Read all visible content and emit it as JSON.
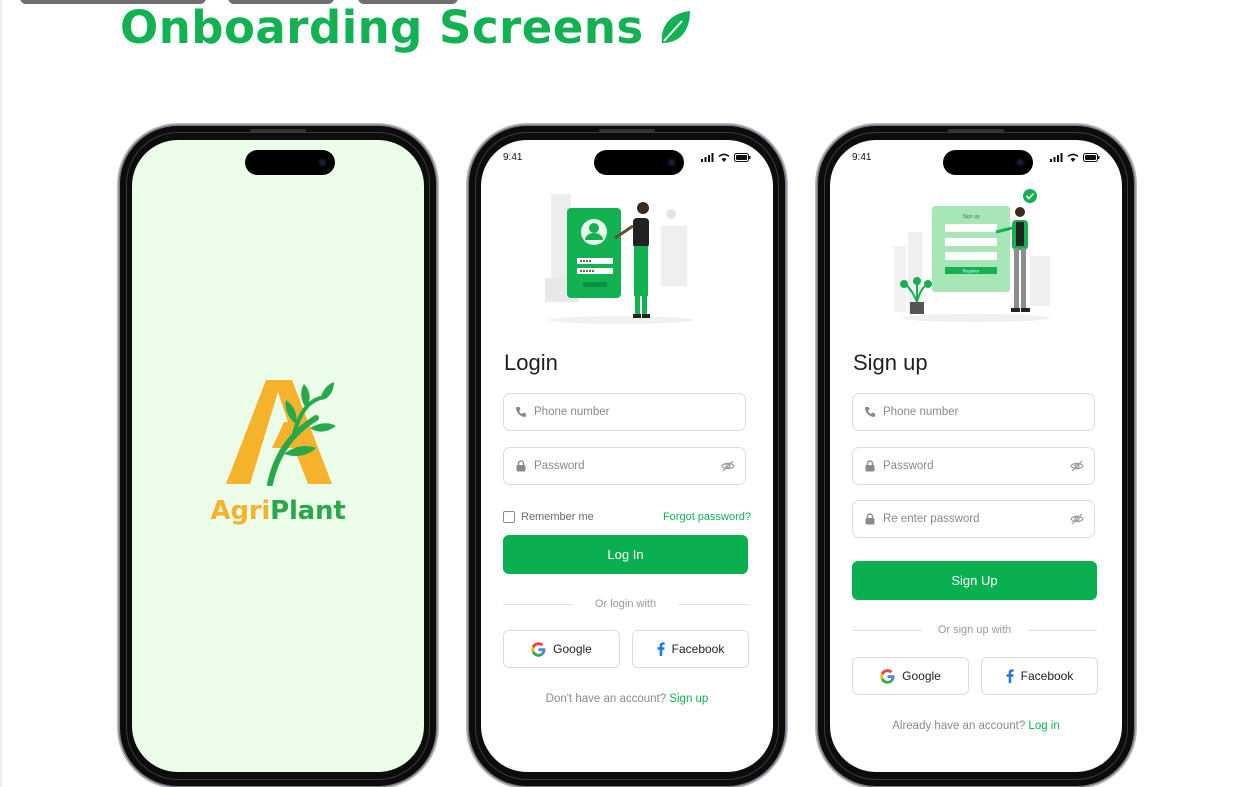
{
  "page": {
    "title": "Onboarding Screens",
    "accent": "#12b152"
  },
  "splash": {
    "brand_part1": "Agri",
    "brand_part2": "Plant",
    "brand_colors": [
      "#f4b32a",
      "#29a84a"
    ],
    "background": "#ebfde9"
  },
  "status": {
    "time": "9:41"
  },
  "login": {
    "title": "Login",
    "phone_placeholder": "Phone number",
    "password_placeholder": "Password",
    "remember_label": "Remember me",
    "forgot_label": "Forgot password?",
    "submit_label": "Log In",
    "divider_label": "Or login with",
    "google_label": "Google",
    "facebook_label": "Facebook",
    "footer_text": "Don't have an account?",
    "footer_link": "Sign up"
  },
  "signup": {
    "title": "Sign up",
    "phone_placeholder": "Phone number",
    "password_placeholder": "Password",
    "reenter_placeholder": "Re enter password",
    "submit_label": "Sign Up",
    "divider_label": "Or sign up with",
    "google_label": "Google",
    "facebook_label": "Facebook",
    "footer_text": "Already have an account?",
    "footer_link": "Log in",
    "illustration_form_title": "Sign up",
    "illustration_button": "Register"
  },
  "icons": [
    "leaf-icon",
    "phone-icon",
    "lock-icon",
    "eye-off-icon",
    "google-icon",
    "facebook-icon",
    "signal-icon",
    "wifi-icon",
    "battery-icon",
    "check-badge-icon"
  ]
}
